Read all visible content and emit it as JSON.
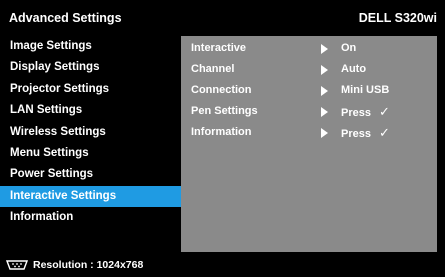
{
  "header": {
    "title": "Advanced Settings",
    "model": "DELL S320wi"
  },
  "sidebar": {
    "items": [
      {
        "label": "Image Settings"
      },
      {
        "label": "Display Settings"
      },
      {
        "label": "Projector Settings"
      },
      {
        "label": "LAN Settings"
      },
      {
        "label": "Wireless Settings"
      },
      {
        "label": "Menu Settings"
      },
      {
        "label": "Power Settings"
      },
      {
        "label": "Interactive Settings",
        "active": true
      },
      {
        "label": "Information"
      }
    ]
  },
  "panel": {
    "rows": [
      {
        "label": "Interactive",
        "value": "On"
      },
      {
        "label": "Channel",
        "value": "Auto"
      },
      {
        "label": "Connection",
        "value": "Mini USB"
      },
      {
        "label": "Pen Settings",
        "value": "Press",
        "check": "✓"
      },
      {
        "label": "Information",
        "value": "Press",
        "check": "✓"
      }
    ]
  },
  "footer": {
    "resolution_text": "Resolution : 1024x768",
    "icon": "display-connector-icon"
  },
  "colors": {
    "background": "#000000",
    "accent": "#1f9be3",
    "panel": "#8a8a8a",
    "text": "#ffffff"
  }
}
